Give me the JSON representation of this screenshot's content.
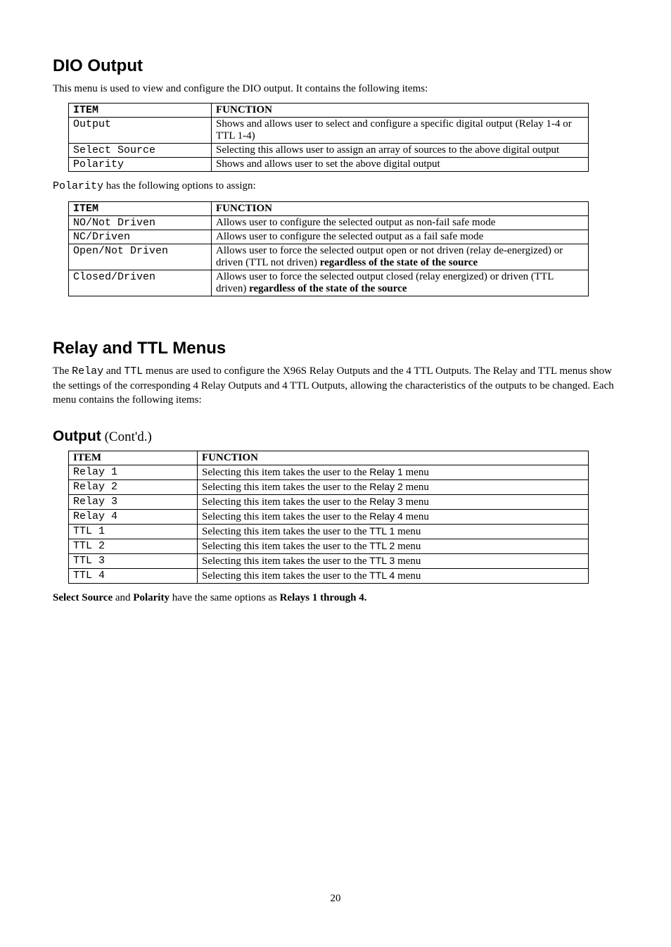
{
  "s1": {
    "heading": "DIO Output",
    "intro": "This menu is used to view and configure the DIO output.  It contains the following items:",
    "table": {
      "h1": "ITEM",
      "h2": "FUNCTION",
      "rows": [
        {
          "item": "Output",
          "func": "Shows and allows user to select and configure a specific digital output (Relay 1-4 or TTL 1-4)"
        },
        {
          "item": "Select Source",
          "func": "Selecting this allows user to assign an array of sources to the above digital output"
        },
        {
          "item": "Polarity",
          "func": "Shows and allows user to set the above digital output"
        }
      ]
    },
    "polarity_intro_pre": "Polarity",
    "polarity_intro_post": " has the following options to assign:",
    "table2": {
      "h1": "ITEM",
      "h2": "FUNCTION",
      "rows": [
        {
          "item": "NO/Not Driven",
          "func": "Allows user to configure the selected output as non-fail safe mode"
        },
        {
          "item": "NC/Driven",
          "func": "Allows user to configure the selected output as a fail safe mode"
        },
        {
          "item": "Open/Not Driven",
          "func_a": "Allows user to force the selected output open or not driven (relay de-energized) or driven (TTL not driven) ",
          "func_b": "regardless of the state of the source"
        },
        {
          "item": "Closed/Driven",
          "func_a": "Allows user to force the selected output closed (relay energized) or driven (TTL driven) ",
          "func_b": "regardless of the state of the source"
        }
      ]
    }
  },
  "s2": {
    "heading": "Relay and TTL Menus",
    "intro_a": "The ",
    "intro_b": "Relay",
    "intro_c": " and ",
    "intro_d": "TTL",
    "intro_e": " menus are used to configure the X96S Relay Outputs and the 4 TTL Outputs. The Relay and TTL menus show the settings of the corresponding 4 Relay Outputs and 4 TTL Outputs, allowing the characteristics of the outputs to be changed.  Each menu contains the following items:"
  },
  "s3": {
    "heading": "Output",
    "contd": " (Cont'd.)",
    "table": {
      "h1": "ITEM",
      "h2": "FUNCTION",
      "rows": [
        {
          "item": "Relay 1",
          "func_a": "Selecting this item takes the user to the ",
          "func_b": "Relay 1",
          "func_c": " menu"
        },
        {
          "item": "Relay 2",
          "func_a": "Selecting this item takes the user to the ",
          "func_b": "Relay 2",
          "func_c": " menu"
        },
        {
          "item": "Relay 3",
          "func_a": "Selecting this item takes the user to the ",
          "func_b": "Relay 3",
          "func_c": " menu"
        },
        {
          "item": "Relay 4",
          "func_a": "Selecting this item takes the user to the ",
          "func_b": "Relay 4",
          "func_c": " menu"
        },
        {
          "item": "TTL 1",
          "func_a": "Selecting this item takes the user to the ",
          "func_b": "TTL 1",
          "func_c": " menu"
        },
        {
          "item": "TTL 2",
          "func_a": "Selecting this item takes the user to the ",
          "func_b": "TTL 2",
          "func_c": " menu"
        },
        {
          "item": "TTL 3",
          "func_a": "Selecting this item takes the user to the ",
          "func_b": "TTL 3",
          "func_c": " menu"
        },
        {
          "item": "TTL 4",
          "func_a": "Selecting this item takes the user to the ",
          "func_b": "TTL 4",
          "func_c": " menu"
        }
      ]
    },
    "note_a": "Select Source",
    "note_b": " and ",
    "note_c": "Polarity",
    "note_d": " have the same options as ",
    "note_e": "Relays 1 through 4."
  },
  "page_number": "20"
}
